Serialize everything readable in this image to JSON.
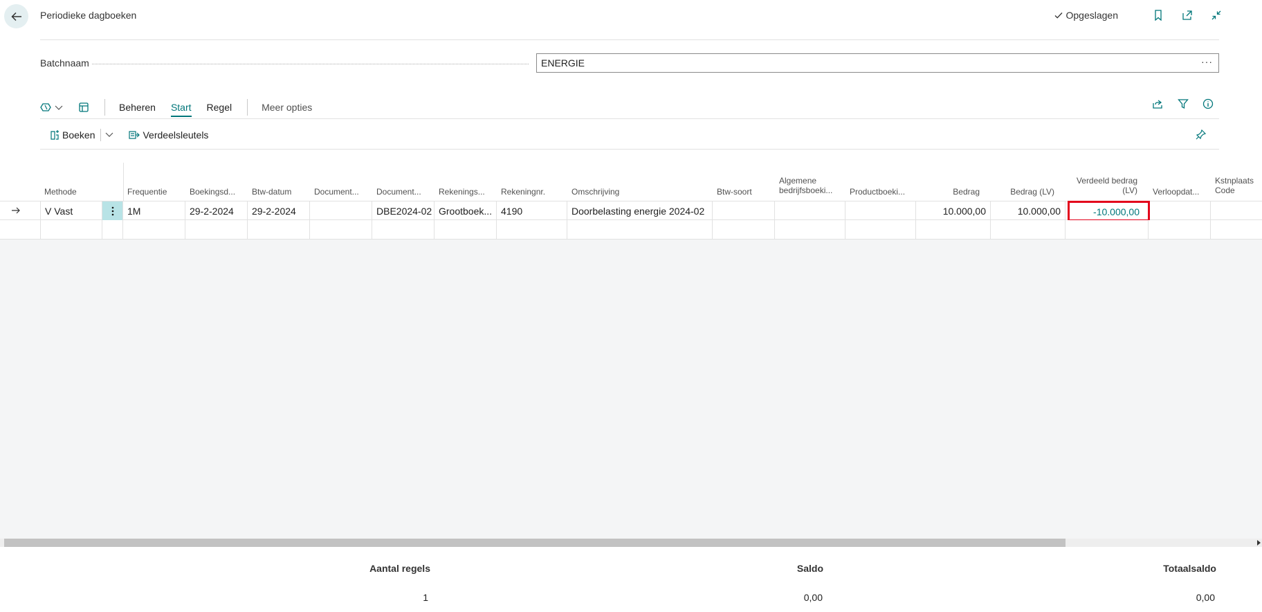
{
  "header": {
    "title": "Periodieke dagboeken",
    "saved_label": "Opgeslagen"
  },
  "batch": {
    "label": "Batchnaam",
    "value": "ENERGIE",
    "more": "···"
  },
  "actionbar": {
    "tabs": [
      "Beheren",
      "Start",
      "Regel"
    ],
    "active_tab": "Start",
    "more_options": "Meer opties"
  },
  "subbar": {
    "post_label": "Boeken",
    "allocations_label": "Verdeelsleutels"
  },
  "grid": {
    "columns": [
      "Methode",
      "Frequentie",
      "Boekingsd...",
      "Btw-datum",
      "Document...",
      "Document...",
      "Rekenings...",
      "Rekeningnr.",
      "Omschrijving",
      "Btw-soort",
      "Algemene bedrijfsboeki...",
      "Productboeki...",
      "Bedrag",
      "Bedrag (LV)",
      "Verdeeld bedrag (LV)",
      "Verloopdat...",
      "Kstnplaats Code"
    ],
    "rows": [
      {
        "methode": "V Vast",
        "frequentie": "1M",
        "boekingsdatum": "29-2-2024",
        "btw_datum": "29-2-2024",
        "document_type": "",
        "document_nr": "DBE2024-02",
        "rekeningsoort": "Grootboek...",
        "rekeningnr": "4190",
        "omschrijving": "Doorbelasting energie 2024-02",
        "btw_soort": "",
        "alg_bedrijfsboekingsgroep": "",
        "productboekingsgroep": "",
        "bedrag": "10.000,00",
        "bedrag_lv": "10.000,00",
        "verdeeld_bedrag_lv": "-10.000,00",
        "verloopdatum": "",
        "kostenplaats": ""
      }
    ]
  },
  "totals": {
    "aantal_regels_label": "Aantal regels",
    "aantal_regels": "1",
    "saldo_label": "Saldo",
    "saldo": "0,00",
    "totaalsaldo_label": "Totaalsaldo",
    "totaalsaldo": "0,00"
  },
  "colors": {
    "accent": "#00767a",
    "highlight": "#e3001b",
    "selected_cell": "#b8e3e6"
  }
}
